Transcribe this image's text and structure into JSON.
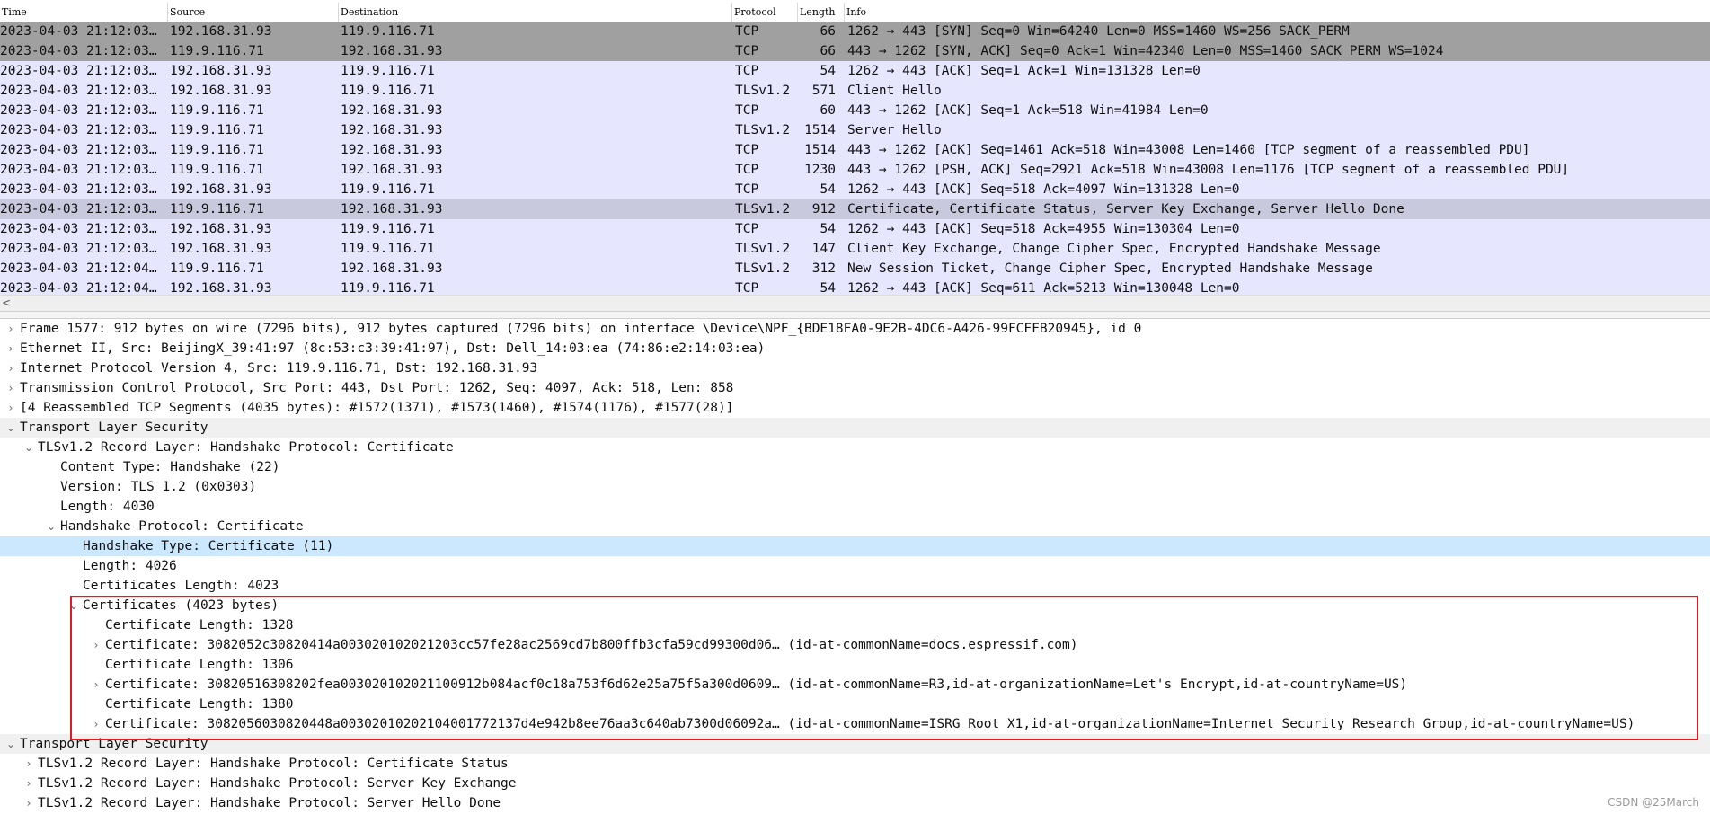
{
  "packet_list": {
    "columns": [
      "Time",
      "Source",
      "Destination",
      "Protocol",
      "Length",
      "Info"
    ],
    "rows": [
      {
        "time": "2023-04-03 21:12:03…",
        "src": "192.168.31.93",
        "dst": "119.9.116.71",
        "proto": "TCP",
        "len": "66",
        "info": "1262 → 443 [SYN] Seq=0 Win=64240 Len=0 MSS=1460 WS=256 SACK_PERM",
        "bg": "#a0a0a0"
      },
      {
        "time": "2023-04-03 21:12:03…",
        "src": "119.9.116.71",
        "dst": "192.168.31.93",
        "proto": "TCP",
        "len": "66",
        "info": "443 → 1262 [SYN, ACK] Seq=0 Ack=1 Win=42340 Len=0 MSS=1460 SACK_PERM WS=1024",
        "bg": "#a0a0a0"
      },
      {
        "time": "2023-04-03 21:12:03…",
        "src": "192.168.31.93",
        "dst": "119.9.116.71",
        "proto": "TCP",
        "len": "54",
        "info": "1262 → 443 [ACK] Seq=1 Ack=1 Win=131328 Len=0",
        "bg": "#e7e6ff"
      },
      {
        "time": "2023-04-03 21:12:03…",
        "src": "192.168.31.93",
        "dst": "119.9.116.71",
        "proto": "TLSv1.2",
        "len": "571",
        "info": "Client Hello",
        "bg": "#e7e6ff"
      },
      {
        "time": "2023-04-03 21:12:03…",
        "src": "119.9.116.71",
        "dst": "192.168.31.93",
        "proto": "TCP",
        "len": "60",
        "info": "443 → 1262 [ACK] Seq=1 Ack=518 Win=41984 Len=0",
        "bg": "#e7e6ff"
      },
      {
        "time": "2023-04-03 21:12:03…",
        "src": "119.9.116.71",
        "dst": "192.168.31.93",
        "proto": "TLSv1.2",
        "len": "1514",
        "info": "Server Hello",
        "bg": "#e7e6ff"
      },
      {
        "time": "2023-04-03 21:12:03…",
        "src": "119.9.116.71",
        "dst": "192.168.31.93",
        "proto": "TCP",
        "len": "1514",
        "info": "443 → 1262 [ACK] Seq=1461 Ack=518 Win=43008 Len=1460 [TCP segment of a reassembled PDU]",
        "bg": "#e7e6ff"
      },
      {
        "time": "2023-04-03 21:12:03…",
        "src": "119.9.116.71",
        "dst": "192.168.31.93",
        "proto": "TCP",
        "len": "1230",
        "info": "443 → 1262 [PSH, ACK] Seq=2921 Ack=518 Win=43008 Len=1176 [TCP segment of a reassembled PDU]",
        "bg": "#e7e6ff"
      },
      {
        "time": "2023-04-03 21:12:03…",
        "src": "192.168.31.93",
        "dst": "119.9.116.71",
        "proto": "TCP",
        "len": "54",
        "info": "1262 → 443 [ACK] Seq=518 Ack=4097 Win=131328 Len=0",
        "bg": "#e7e6ff"
      },
      {
        "time": "2023-04-03 21:12:03…",
        "src": "119.9.116.71",
        "dst": "192.168.31.93",
        "proto": "TLSv1.2",
        "len": "912",
        "info": "Certificate, Certificate Status, Server Key Exchange, Server Hello Done",
        "bg": "#c9c9de"
      },
      {
        "time": "2023-04-03 21:12:03…",
        "src": "192.168.31.93",
        "dst": "119.9.116.71",
        "proto": "TCP",
        "len": "54",
        "info": "1262 → 443 [ACK] Seq=518 Ack=4955 Win=130304 Len=0",
        "bg": "#e7e6ff"
      },
      {
        "time": "2023-04-03 21:12:03…",
        "src": "192.168.31.93",
        "dst": "119.9.116.71",
        "proto": "TLSv1.2",
        "len": "147",
        "info": "Client Key Exchange, Change Cipher Spec, Encrypted Handshake Message",
        "bg": "#e7e6ff"
      },
      {
        "time": "2023-04-03 21:12:04…",
        "src": "119.9.116.71",
        "dst": "192.168.31.93",
        "proto": "TLSv1.2",
        "len": "312",
        "info": "New Session Ticket, Change Cipher Spec, Encrypted Handshake Message",
        "bg": "#e7e6ff"
      },
      {
        "time": "2023-04-03 21:12:04…",
        "src": "192.168.31.93",
        "dst": "119.9.116.71",
        "proto": "TCP",
        "len": "54",
        "info": "1262 → 443 [ACK] Seq=611 Ack=5213 Win=130048 Len=0",
        "bg": "#e7e6ff"
      }
    ]
  },
  "details": [
    {
      "level": 0,
      "toggle": "›",
      "text": "Frame 1577: 912 bytes on wire (7296 bits), 912 bytes captured (7296 bits) on interface \\Device\\NPF_{BDE18FA0-9E2B-4DC6-A426-99FCFFB20945}, id 0",
      "bg": "#ffffff"
    },
    {
      "level": 0,
      "toggle": "›",
      "text": "Ethernet II, Src: BeijingX_39:41:97 (8c:53:c3:39:41:97), Dst: Dell_14:03:ea (74:86:e2:14:03:ea)",
      "bg": "#ffffff"
    },
    {
      "level": 0,
      "toggle": "›",
      "text": "Internet Protocol Version 4, Src: 119.9.116.71, Dst: 192.168.31.93",
      "bg": "#ffffff"
    },
    {
      "level": 0,
      "toggle": "›",
      "text": "Transmission Control Protocol, Src Port: 443, Dst Port: 1262, Seq: 4097, Ack: 518, Len: 858",
      "bg": "#ffffff"
    },
    {
      "level": 0,
      "toggle": "›",
      "text": "[4 Reassembled TCP Segments (4035 bytes): #1572(1371), #1573(1460), #1574(1176), #1577(28)]",
      "bg": "#ffffff"
    },
    {
      "level": 0,
      "toggle": "⌄",
      "text": "Transport Layer Security",
      "bg": "#f0f0f0"
    },
    {
      "level": 1,
      "toggle": "⌄",
      "text": "TLSv1.2 Record Layer: Handshake Protocol: Certificate",
      "bg": "#ffffff"
    },
    {
      "level": 2,
      "toggle": "",
      "text": "Content Type: Handshake (22)",
      "bg": "#ffffff"
    },
    {
      "level": 2,
      "toggle": "",
      "text": "Version: TLS 1.2 (0x0303)",
      "bg": "#ffffff"
    },
    {
      "level": 2,
      "toggle": "",
      "text": "Length: 4030",
      "bg": "#ffffff"
    },
    {
      "level": 2,
      "toggle": "⌄",
      "text": "Handshake Protocol: Certificate",
      "bg": "#ffffff"
    },
    {
      "level": 3,
      "toggle": "",
      "text": "Handshake Type: Certificate (11)",
      "bg": "#cce8ff"
    },
    {
      "level": 3,
      "toggle": "",
      "text": "Length: 4026",
      "bg": "#ffffff"
    },
    {
      "level": 3,
      "toggle": "",
      "text": "Certificates Length: 4023",
      "bg": "#ffffff"
    },
    {
      "level": 3,
      "toggle": "⌄",
      "text": "Certificates (4023 bytes)",
      "bg": "#ffffff"
    },
    {
      "level": 4,
      "toggle": "",
      "text": "Certificate Length: 1328",
      "bg": "#ffffff"
    },
    {
      "level": 4,
      "toggle": "›",
      "text": "Certificate: 3082052c30820414a003020102021203cc57fe28ac2569cd7b800ffb3cfa59cd99300d06… (id-at-commonName=docs.espressif.com)",
      "bg": "#ffffff"
    },
    {
      "level": 4,
      "toggle": "",
      "text": "Certificate Length: 1306",
      "bg": "#ffffff"
    },
    {
      "level": 4,
      "toggle": "›",
      "text": "Certificate: 30820516308202fea003020102021100912b084acf0c18a753f6d62e25a75f5a300d0609… (id-at-commonName=R3,id-at-organizationName=Let's Encrypt,id-at-countryName=US)",
      "bg": "#ffffff"
    },
    {
      "level": 4,
      "toggle": "",
      "text": "Certificate Length: 1380",
      "bg": "#ffffff"
    },
    {
      "level": 4,
      "toggle": "›",
      "text": "Certificate: 3082056030820448a00302010202104001772137d4e942b8ee76aa3c640ab7300d06092a… (id-at-commonName=ISRG Root X1,id-at-organizationName=Internet Security Research Group,id-at-countryName=US)",
      "bg": "#ffffff"
    },
    {
      "level": 0,
      "toggle": "⌄",
      "text": "Transport Layer Security",
      "bg": "#f0f0f0"
    },
    {
      "level": 1,
      "toggle": "›",
      "text": "TLSv1.2 Record Layer: Handshake Protocol: Certificate Status",
      "bg": "#ffffff"
    },
    {
      "level": 1,
      "toggle": "›",
      "text": "TLSv1.2 Record Layer: Handshake Protocol: Server Key Exchange",
      "bg": "#ffffff"
    },
    {
      "level": 1,
      "toggle": "›",
      "text": "TLSv1.2 Record Layer: Handshake Protocol: Server Hello Done",
      "bg": "#ffffff"
    }
  ],
  "scroll_arrow": "<",
  "watermark": "CSDN @25March"
}
